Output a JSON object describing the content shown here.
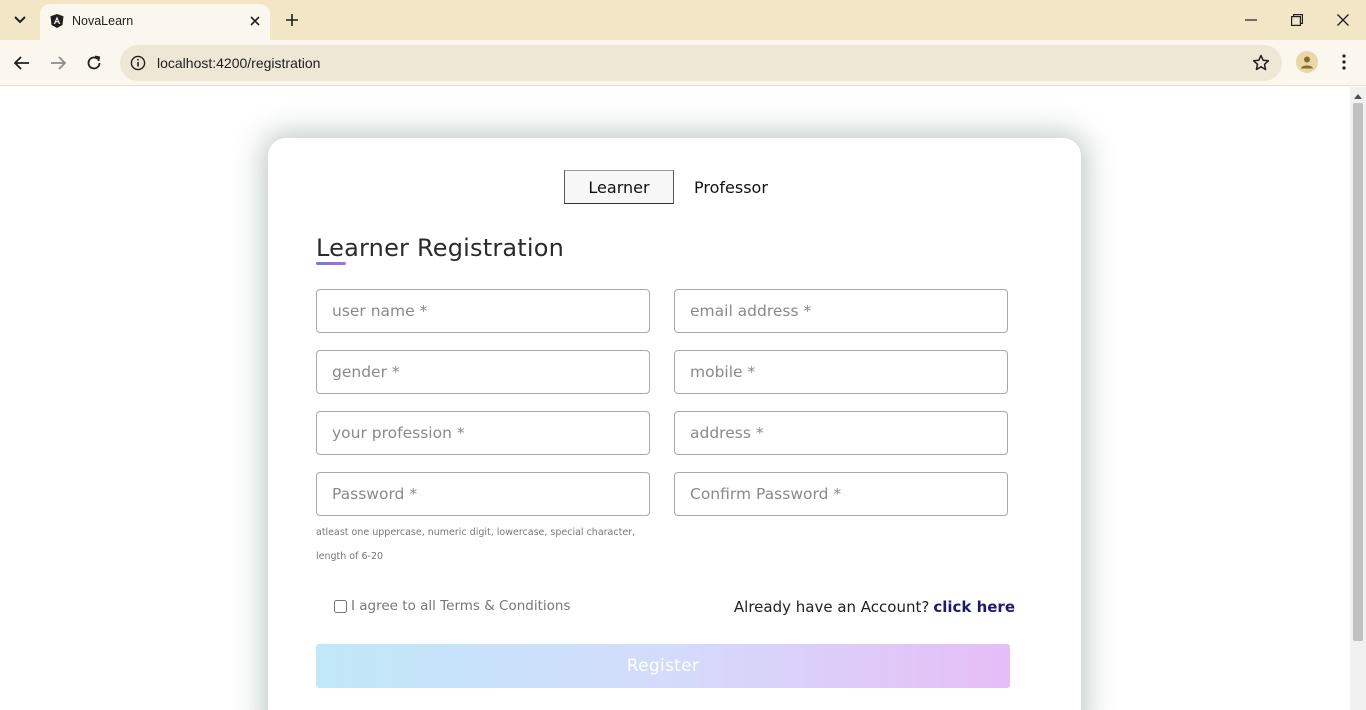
{
  "browser": {
    "tab_title": "NovaLearn",
    "url": "localhost:4200/registration",
    "icons": [
      "tab-search-icon",
      "angular-favicon-icon",
      "close-icon",
      "plus-icon",
      "minimize-icon",
      "restore-icon",
      "close-window-icon",
      "back-icon",
      "forward-icon",
      "reload-icon",
      "site-info-icon",
      "star-icon",
      "profile-icon",
      "kebab-menu-icon"
    ]
  },
  "role_tabs": {
    "learner": "Learner",
    "professor": "Professor",
    "active": "Learner"
  },
  "form": {
    "title": "Learner Registration",
    "fields": {
      "username": {
        "placeholder": "user name *",
        "value": ""
      },
      "email": {
        "placeholder": "email address *",
        "value": ""
      },
      "gender": {
        "placeholder": "gender *",
        "value": ""
      },
      "mobile": {
        "placeholder": "mobile *",
        "value": ""
      },
      "profession": {
        "placeholder": "your profession *",
        "value": ""
      },
      "address": {
        "placeholder": "address *",
        "value": ""
      },
      "password": {
        "placeholder": "Password *",
        "value": ""
      },
      "confirm_password": {
        "placeholder": "Confirm Password *",
        "value": ""
      }
    },
    "password_hint": "atleast one uppercase, numeric digit, lowercase, special character, length of 6-20",
    "terms_label": "I agree to all Terms & Conditions",
    "terms_checked": false,
    "account_prompt": "Already have an Account?",
    "account_link": "click here",
    "register_label": "Register"
  },
  "colors": {
    "tabstrip_bg": "#f3e6c6",
    "toolbar_bg": "#fbf7ee",
    "link_color": "#1c1c6e",
    "register_gradient_start": "#bfe8f8",
    "register_gradient_end": "#e6bdf7"
  }
}
